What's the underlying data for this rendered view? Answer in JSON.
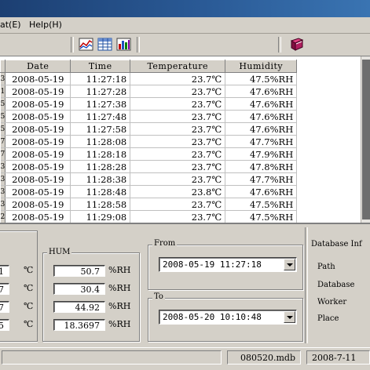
{
  "menu": {
    "format_label": "at(E)",
    "help_label": "Help(H)"
  },
  "toolbar": {
    "icons": [
      "chart-icon",
      "table-icon",
      "bar-chart-icon",
      "book-icon"
    ]
  },
  "grid": {
    "columns": [
      "Date",
      "Time",
      "Temperature",
      "Humidity"
    ],
    "row_markers": [
      "3",
      "1",
      "5",
      "5",
      "5",
      "7",
      "7",
      "3",
      "3",
      "3",
      "3",
      "2"
    ],
    "rows": [
      {
        "date": "2008-05-19",
        "time": "11:27:18",
        "temp": "23.7℃",
        "hum": "47.5%RH"
      },
      {
        "date": "2008-05-19",
        "time": "11:27:28",
        "temp": "23.7℃",
        "hum": "47.6%RH"
      },
      {
        "date": "2008-05-19",
        "time": "11:27:38",
        "temp": "23.7℃",
        "hum": "47.6%RH"
      },
      {
        "date": "2008-05-19",
        "time": "11:27:48",
        "temp": "23.7℃",
        "hum": "47.6%RH"
      },
      {
        "date": "2008-05-19",
        "time": "11:27:58",
        "temp": "23.7℃",
        "hum": "47.6%RH"
      },
      {
        "date": "2008-05-19",
        "time": "11:28:08",
        "temp": "23.7℃",
        "hum": "47.7%RH"
      },
      {
        "date": "2008-05-19",
        "time": "11:28:18",
        "temp": "23.7℃",
        "hum": "47.9%RH"
      },
      {
        "date": "2008-05-19",
        "time": "11:28:28",
        "temp": "23.7℃",
        "hum": "47.8%RH"
      },
      {
        "date": "2008-05-19",
        "time": "11:28:38",
        "temp": "23.7℃",
        "hum": "47.7%RH"
      },
      {
        "date": "2008-05-19",
        "time": "11:28:48",
        "temp": "23.8℃",
        "hum": "47.6%RH"
      },
      {
        "date": "2008-05-19",
        "time": "11:28:58",
        "temp": "23.7℃",
        "hum": "47.5%RH"
      },
      {
        "date": "2008-05-19",
        "time": "11:29:08",
        "temp": "23.7℃",
        "hum": "47.5%RH"
      }
    ]
  },
  "temp_panel": {
    "values": [
      "1",
      "7",
      "7",
      "5"
    ],
    "unit": "℃"
  },
  "hum_panel": {
    "title": "HUM",
    "values": [
      "50.7",
      "30.4",
      "44.92",
      "18.3697"
    ],
    "unit": "%RH"
  },
  "range": {
    "from_label": "From",
    "from_value": "2008-05-19 11:27:18",
    "to_label": "To",
    "to_value": "2008-05-20 10:10:48"
  },
  "database_info": {
    "title": "Database Inf",
    "labels": [
      "Path",
      "Database",
      "Worker",
      "Place"
    ]
  },
  "status": {
    "file": "080520.mdb",
    "date": "2008-7-11"
  }
}
